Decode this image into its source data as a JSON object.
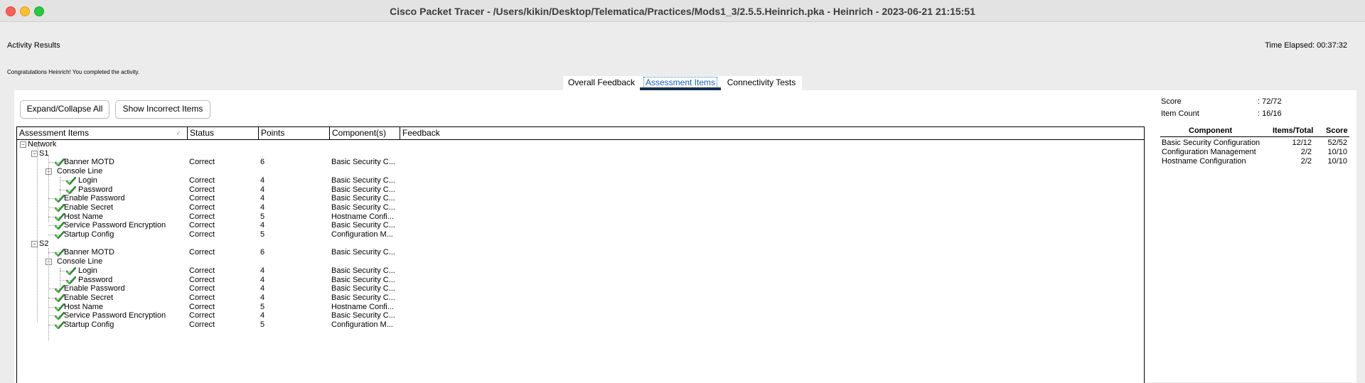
{
  "window": {
    "title": "Cisco Packet Tracer - /Users/kikin/Desktop/Telematica/Practices/Mods1_3/2.5.5.Heinrich.pka - Heinrich - 2023-06-21 21:15:51"
  },
  "header": {
    "activity_results": "Activity Results",
    "time_elapsed": "Time Elapsed: 00:37:32",
    "congrats": "Congratulations Heinrich! You completed the activity."
  },
  "tabs": [
    "Overall Feedback",
    "Assessment Items",
    "Connectivity Tests"
  ],
  "active_tab": "Assessment Items",
  "buttons": {
    "expand": "Expand/Collapse All",
    "incorrect": "Show Incorrect Items"
  },
  "table": {
    "headers": [
      "Assessment Items",
      "Status",
      "Points",
      "Component(s)",
      "Feedback"
    ],
    "rows": [
      {
        "label": "Network",
        "level": 0,
        "type": "group"
      },
      {
        "label": "S1",
        "level": 1,
        "type": "group"
      },
      {
        "label": "Banner MOTD",
        "level": 2,
        "type": "item",
        "status": "Correct",
        "points": "6",
        "component": "Basic Security C..."
      },
      {
        "label": "Console Line",
        "level": 2,
        "type": "group"
      },
      {
        "label": "Login",
        "level": 3,
        "type": "item",
        "status": "Correct",
        "points": "4",
        "component": "Basic Security C..."
      },
      {
        "label": "Password",
        "level": 3,
        "type": "item",
        "status": "Correct",
        "points": "4",
        "component": "Basic Security C..."
      },
      {
        "label": "Enable Password",
        "level": 2,
        "type": "item",
        "status": "Correct",
        "points": "4",
        "component": "Basic Security C..."
      },
      {
        "label": "Enable Secret",
        "level": 2,
        "type": "item",
        "status": "Correct",
        "points": "4",
        "component": "Basic Security C..."
      },
      {
        "label": "Host Name",
        "level": 2,
        "type": "item",
        "status": "Correct",
        "points": "5",
        "component": "Hostname Confi..."
      },
      {
        "label": "Service Password Encryption",
        "level": 2,
        "type": "item",
        "status": "Correct",
        "points": "4",
        "component": "Basic Security C..."
      },
      {
        "label": "Startup Config",
        "level": 2,
        "type": "item",
        "status": "Correct",
        "points": "5",
        "component": "Configuration M..."
      },
      {
        "label": "S2",
        "level": 1,
        "type": "group"
      },
      {
        "label": "Banner MOTD",
        "level": 2,
        "type": "item",
        "status": "Correct",
        "points": "6",
        "component": "Basic Security C..."
      },
      {
        "label": "Console Line",
        "level": 2,
        "type": "group"
      },
      {
        "label": "Login",
        "level": 3,
        "type": "item",
        "status": "Correct",
        "points": "4",
        "component": "Basic Security C..."
      },
      {
        "label": "Password",
        "level": 3,
        "type": "item",
        "status": "Correct",
        "points": "4",
        "component": "Basic Security C..."
      },
      {
        "label": "Enable Password",
        "level": 2,
        "type": "item",
        "status": "Correct",
        "points": "4",
        "component": "Basic Security C..."
      },
      {
        "label": "Enable Secret",
        "level": 2,
        "type": "item",
        "status": "Correct",
        "points": "4",
        "component": "Basic Security C..."
      },
      {
        "label": "Host Name",
        "level": 2,
        "type": "item",
        "status": "Correct",
        "points": "5",
        "component": "Hostname Confi..."
      },
      {
        "label": "Service Password Encryption",
        "level": 2,
        "type": "item",
        "status": "Correct",
        "points": "4",
        "component": "Basic Security C..."
      },
      {
        "label": "Startup Config",
        "level": 2,
        "type": "item",
        "status": "Correct",
        "points": "5",
        "component": "Configuration M..."
      }
    ]
  },
  "summary": {
    "score_label": "Score",
    "score_value": ": 72/72",
    "count_label": "Item Count",
    "count_value": ": 16/16",
    "headers": [
      "Component",
      "Items/Total",
      "Score"
    ],
    "rows": [
      {
        "component": "Basic Security Configuration",
        "items": "12/12",
        "score": "52/52"
      },
      {
        "component": "Configuration Management",
        "items": "2/2",
        "score": "10/10"
      },
      {
        "component": "Hostname Configuration",
        "items": "2/2",
        "score": "10/10"
      }
    ]
  },
  "colors": {
    "check": "#2e8b2e",
    "active_tab_bar": "#16314f",
    "window_bg": "#ececec"
  },
  "icons": {
    "check": "checkmark-icon",
    "collapse": "minus-box-icon"
  }
}
